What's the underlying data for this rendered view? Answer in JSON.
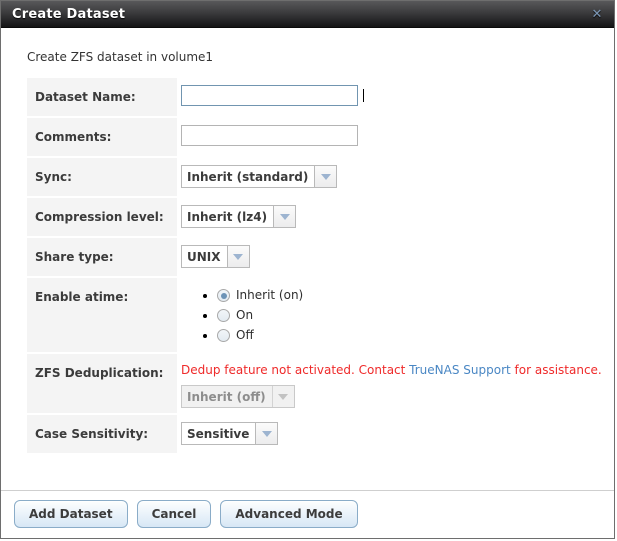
{
  "window": {
    "title": "Create Dataset",
    "close_icon": "close-x-icon"
  },
  "intro": "Create ZFS dataset in volume1",
  "form": {
    "rows": [
      {
        "label": "Dataset Name:",
        "type": "text",
        "value": "",
        "placeholder": ""
      },
      {
        "label": "Comments:",
        "type": "text",
        "value": "",
        "placeholder": ""
      },
      {
        "label": "Sync:",
        "type": "select",
        "value": "Inherit (standard)"
      },
      {
        "label": "Compression level:",
        "type": "select",
        "value": "Inherit (lz4)"
      },
      {
        "label": "Share type:",
        "type": "select",
        "value": "UNIX"
      },
      {
        "label": "Enable atime:",
        "type": "radio"
      },
      {
        "label": "ZFS Deduplication:",
        "type": "warning-select",
        "value": "Inherit (off)"
      },
      {
        "label": "Case Sensitivity:",
        "type": "select",
        "value": "Sensitive"
      }
    ],
    "atime_options": [
      {
        "label": "Inherit (on)",
        "checked": true
      },
      {
        "label": "On",
        "checked": false
      },
      {
        "label": "Off",
        "checked": false
      }
    ],
    "dedup_warning": {
      "before": "Dedup feature not activated. Contact ",
      "link": "TrueNAS Support",
      "after": " for assistance."
    }
  },
  "footer": {
    "add_label": "Add Dataset",
    "cancel_label": "Cancel",
    "advanced_label": "Advanced Mode"
  },
  "colors": {
    "warning_red": "#ef2a2a",
    "link_blue": "#4a87c4",
    "focus_border": "#7195b0",
    "row_bg": "#f4f4f4"
  }
}
